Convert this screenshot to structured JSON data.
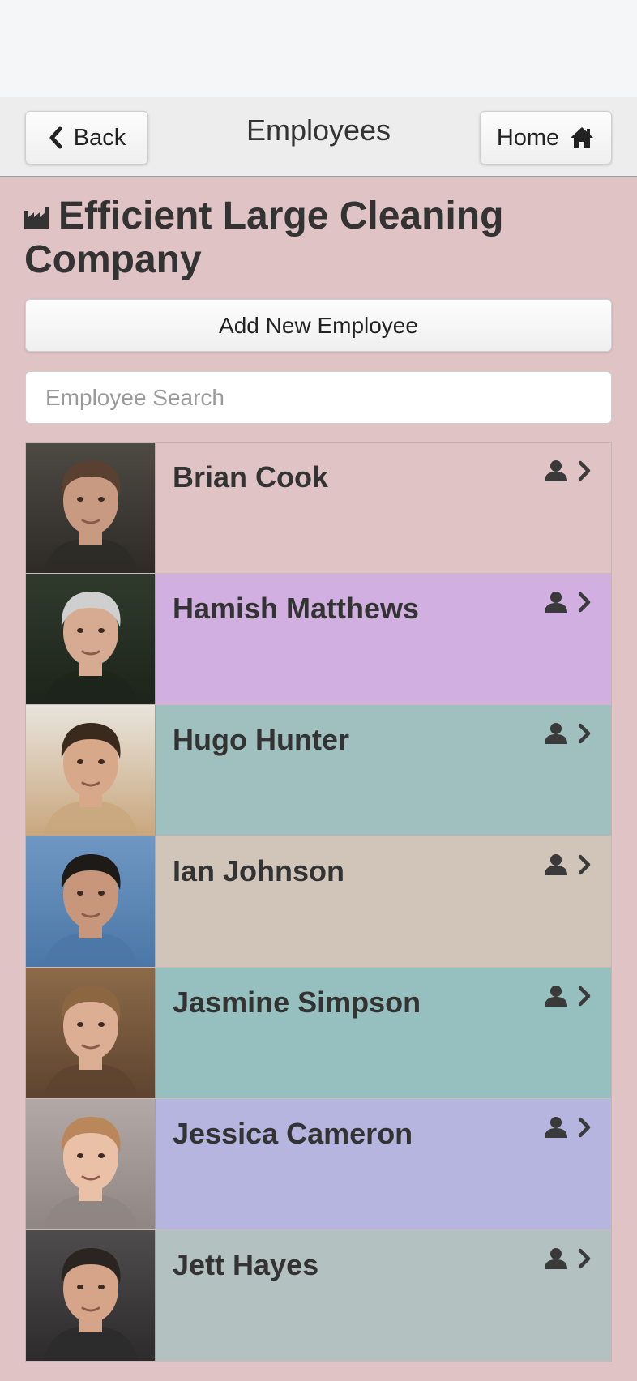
{
  "header": {
    "title": "Employees",
    "back_label": "Back",
    "home_label": "Home"
  },
  "company": {
    "name": "Efficient Large Cleaning Company"
  },
  "actions": {
    "add_label": "Add New Employee"
  },
  "search": {
    "placeholder": "Employee Search",
    "value": ""
  },
  "employees": [
    {
      "name": "Brian Cook",
      "bg": "#e0c3c5",
      "photo": [
        "#4d4a44",
        "#2e2b27"
      ],
      "skin": "#c89a82",
      "hair": "#5a4030"
    },
    {
      "name": "Hamish Matthews",
      "bg": "#d1b0e1",
      "photo": [
        "#2f3a2c",
        "#1d241b"
      ],
      "skin": "#d7ab92",
      "hair": "#cfcfcf"
    },
    {
      "name": "Hugo Hunter",
      "bg": "#a0bfbf",
      "photo": [
        "#e8e4dc",
        "#c9a77e"
      ],
      "skin": "#d8a88a",
      "hair": "#3a2a1e"
    },
    {
      "name": "Ian Johnson",
      "bg": "#d1c4b8",
      "photo": [
        "#6f97c3",
        "#4b77a6"
      ],
      "skin": "#c8967a",
      "hair": "#1e1a17"
    },
    {
      "name": "Jasmine Simpson",
      "bg": "#96c0bf",
      "photo": [
        "#8c6a49",
        "#5e4430"
      ],
      "skin": "#dcae94",
      "hair": "#8c6640"
    },
    {
      "name": "Jessica Cameron",
      "bg": "#b5b5df",
      "photo": [
        "#b2a9a7",
        "#8f8583"
      ],
      "skin": "#eac0a6",
      "hair": "#b9875a"
    },
    {
      "name": "Jett Hayes",
      "bg": "#b4c1c1",
      "photo": [
        "#4e4c4d",
        "#2d2b2c"
      ],
      "skin": "#d6a589",
      "hair": "#2b2522"
    }
  ],
  "icons": {
    "back": "chevron-left-icon",
    "home": "home-icon",
    "company": "industry-icon",
    "row_person": "user-icon",
    "row_chevron": "chevron-right-icon"
  }
}
